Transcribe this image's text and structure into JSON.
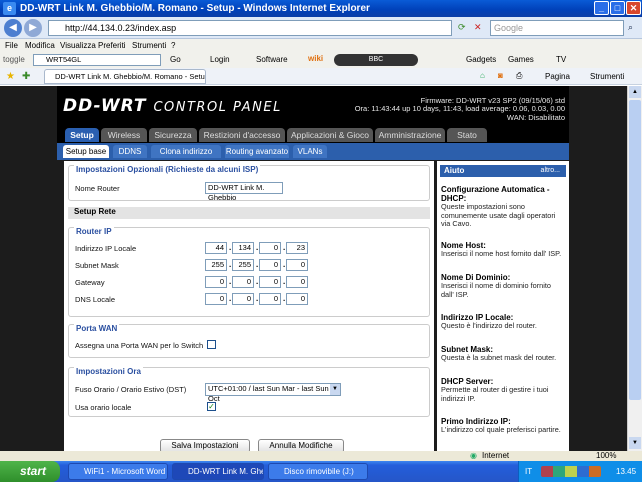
{
  "window": {
    "title": "DD-WRT Link M. Ghebbio/M. Romano - Setup - Windows Internet Explorer"
  },
  "address": {
    "url": "http://44.134.0.23/index.asp",
    "search_placeholder": "Google"
  },
  "menu": [
    "File",
    "Modifica",
    "Visualizza",
    "Preferiti",
    "Strumenti",
    "?"
  ],
  "toolbar": {
    "search_value": "WRT54GL",
    "go": "Go",
    "login": "Login",
    "software": "Software",
    "wiki": "wiki",
    "bbc": "BBC",
    "gadgets": "Gadgets",
    "games": "Games",
    "tv": "TV",
    "toggle": "toggle"
  },
  "favtab": {
    "title": "DD-WRT Link M. Ghebbio/M. Romano - Setup",
    "page": "Pagina",
    "tools": "Strumenti"
  },
  "header": {
    "logo_main": "DD-WRT",
    "logo_sub": "CONTROL PANEL",
    "firmware": "Firmware: DD-WRT v23 SP2 (09/15/06) std",
    "time": "Ora: 11:43:44 up 10 days, 11:43, load average: 0.06, 0.03, 0.00",
    "wan": "WAN: Disabilitato"
  },
  "tabs": [
    "Setup",
    "Wireless",
    "Sicurezza",
    "Restizioni d'accesso",
    "Applicazioni & Gioco",
    "Amministrazione",
    "Stato"
  ],
  "subtabs": [
    "Setup base",
    "DDNS",
    "Clona indirizzo MAC",
    "Routing avanzato",
    "VLANs"
  ],
  "form": {
    "optional_legend": "Impostazioni Opzionali (Richieste da alcuni ISP)",
    "router_name_label": "Nome Router",
    "router_name_value": "DD-WRT Link M. Ghebbio",
    "network_setup": "Setup Rete",
    "router_ip_legend": "Router IP",
    "local_ip_label": "Indirizzo IP Locale",
    "local_ip": [
      "44",
      "134",
      "0",
      "23"
    ],
    "subnet_label": "Subnet Mask",
    "subnet": [
      "255",
      "255",
      "0",
      "0"
    ],
    "gateway_label": "Gateway",
    "gateway": [
      "0",
      "0",
      "0",
      "0"
    ],
    "dns_label": "DNS Locale",
    "dns": [
      "0",
      "0",
      "0",
      "0"
    ],
    "wan_port_legend": "Porta WAN",
    "wan_port_label": "Assegna una Porta WAN per lo Switch",
    "time_legend": "Impostazioni Ora",
    "timezone_label": "Fuso Orario / Orario Estivo (DST)",
    "timezone_value": "UTC+01:00 / last Sun Mar - last Sun Oct",
    "local_time_label": "Usa orario locale",
    "save": "Salva Impostazioni",
    "cancel": "Annulla Modifiche"
  },
  "help": {
    "title": "Aiuto",
    "more": "altro...",
    "items": [
      {
        "h": "Configurazione Automatica - DHCP:",
        "p": "Queste impostazioni sono comunemente usate dagli operatori via Cavo."
      },
      {
        "h": "Nome Host:",
        "p": "Inserisci il nome host fornito dall' ISP."
      },
      {
        "h": "Nome Di Dominio:",
        "p": "Inserisci il nome di dominio fornito dall' ISP."
      },
      {
        "h": "Indirizzo IP Locale:",
        "p": "Questo è l'indirizzo del router."
      },
      {
        "h": "Subnet Mask:",
        "p": "Questa è la subnet mask del router."
      },
      {
        "h": "DHCP Server:",
        "p": "Permette al router di gestire i tuoi indirizzi IP."
      },
      {
        "h": "Primo Indirizzo IP:",
        "p": "L'indirizzo col quale preferisci partire."
      }
    ]
  },
  "status": {
    "zone": "Internet",
    "zoom": "100%"
  },
  "taskbar": {
    "start": "start",
    "tasks": [
      "WiFi1 - Microsoft Word",
      "DD-WRT Link M. Ghe...",
      "Disco rimovibile (J:)"
    ],
    "lang": "IT",
    "clock": "13.45"
  }
}
